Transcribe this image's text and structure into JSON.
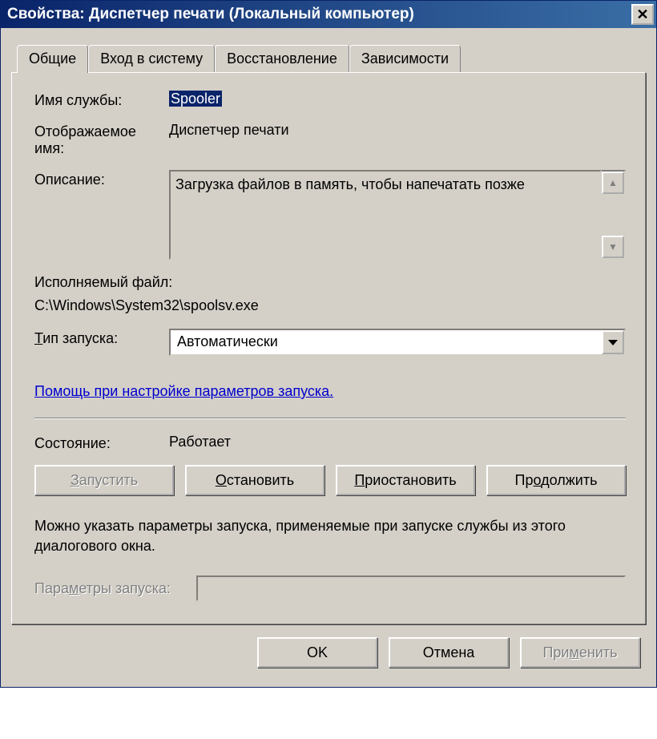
{
  "title": "Свойства: Диспетчер печати (Локальный компьютер)",
  "tabs": {
    "general": "Общие",
    "logon": "Вход в систему",
    "recovery": "Восстановление",
    "dependencies": "Зависимости"
  },
  "labels": {
    "service_name": "Имя службы:",
    "display_name": "Отображаемое имя:",
    "description": "Описание:",
    "exe_label": "Исполняемый файл:",
    "startup_type": "Тип запуска:",
    "help_link": "Помощь при настройке параметров запуска.",
    "status": "Состояние:",
    "hint": "Можно указать параметры запуска, применяемые при запуске службы из этого диалогового окна.",
    "params": "Параметры запуска:"
  },
  "values": {
    "service_name": "Spooler",
    "display_name": "Диспетчер печати",
    "description": "Загрузка файлов в память, чтобы напечатать позже",
    "exe_path": "C:\\Windows\\System32\\spoolsv.exe",
    "startup_type": "Автоматически",
    "status": "Работает",
    "params": ""
  },
  "buttons": {
    "start": "Запустить",
    "stop": "Остановить",
    "pause": "Приостановить",
    "resume": "Продолжить",
    "ok": "OK",
    "cancel": "Отмена",
    "apply": "Применить"
  }
}
